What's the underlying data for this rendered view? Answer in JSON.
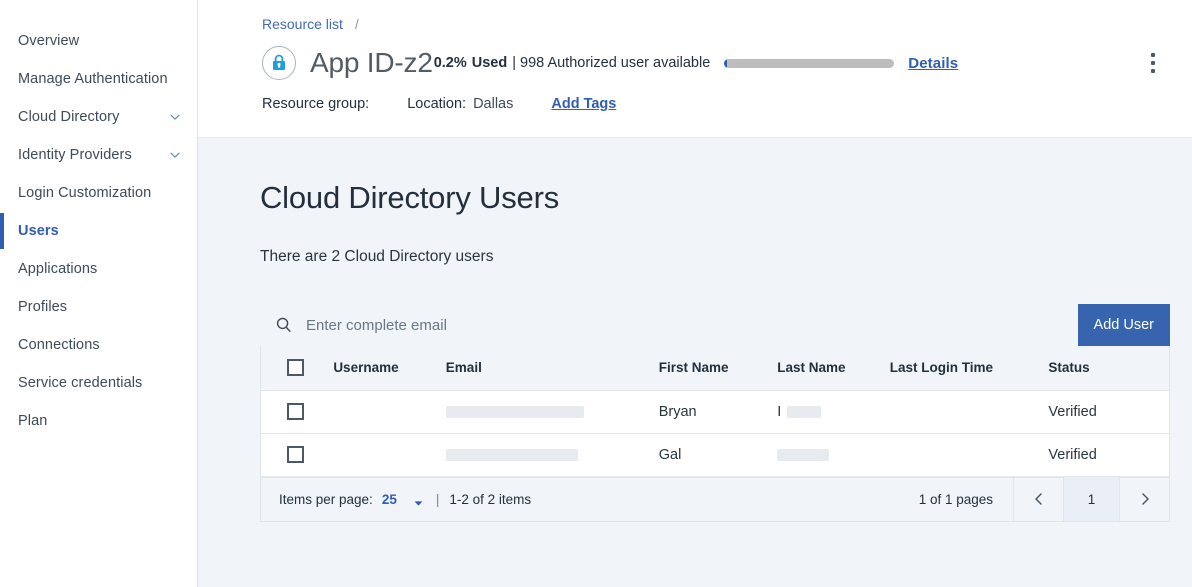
{
  "sidebar": {
    "items": [
      {
        "label": "Overview",
        "icon": null,
        "active": false
      },
      {
        "label": "Manage Authentication",
        "icon": null,
        "active": false
      },
      {
        "label": "Cloud Directory",
        "icon": "chevron-down-icon",
        "active": false
      },
      {
        "label": "Identity Providers",
        "icon": "chevron-down-icon",
        "active": false
      },
      {
        "label": "Login Customization",
        "icon": null,
        "active": false
      },
      {
        "label": "Users",
        "icon": null,
        "active": true
      },
      {
        "label": "Applications",
        "icon": null,
        "active": false
      },
      {
        "label": "Profiles",
        "icon": null,
        "active": false
      },
      {
        "label": "Connections",
        "icon": null,
        "active": false
      },
      {
        "label": "Service credentials",
        "icon": null,
        "active": false
      },
      {
        "label": "Plan",
        "icon": null,
        "active": false
      }
    ]
  },
  "header": {
    "breadcrumb": {
      "link": "Resource list",
      "separator": "/"
    },
    "resource_icon": "lock-shield-icon",
    "app_title": "App ID-z2",
    "usage_percent": "0.2%",
    "usage_used_label": "Used",
    "usage_detail": "| 998 Authorized user available",
    "usage_bar_fill_percent": 2,
    "details_link": "Details",
    "overflow_menu_icon": "kebab-menu-icon",
    "resource_group_label": "Resource group:",
    "resource_group_value": "",
    "location_label": "Location:",
    "location_value": "Dallas",
    "add_tags_link": "Add Tags"
  },
  "content": {
    "page_title": "Cloud Directory Users",
    "page_subtitle": "There are 2 Cloud Directory users",
    "search": {
      "icon": "search-icon",
      "placeholder": "Enter complete email",
      "value": ""
    },
    "add_user_button": "Add User",
    "table": {
      "select_all_checkbox": "checkbox-unchecked",
      "columns": [
        "Username",
        "Email",
        "First Name",
        "Last Name",
        "Last Login Time",
        "Status"
      ],
      "rows": [
        {
          "username": "",
          "email": "",
          "email_redacted": true,
          "first_name": "Bryan",
          "last_name": "I",
          "last_name_redacted": true,
          "last_login_time": "",
          "status": "Verified"
        },
        {
          "username": "",
          "email": "",
          "email_redacted": true,
          "first_name": "Gal",
          "last_name": "",
          "last_name_redacted": true,
          "last_login_time": "",
          "status": "Verified"
        }
      ]
    },
    "pagination": {
      "items_per_page_label": "Items per page:",
      "items_per_page_value": "25",
      "dropdown_icon": "caret-down-icon",
      "divider": "|",
      "range_text": "1-2 of 2 items",
      "pages_text": "1 of 1 pages",
      "prev_icon": "chevron-left-icon",
      "current_page": "1",
      "next_icon": "chevron-right-icon"
    }
  },
  "colors": {
    "accent_blue": "#2f5eb3",
    "button_blue": "#3664ae",
    "page_bg": "#f1f4f9",
    "text_dark": "#23303d",
    "progress_track": "#bdbdbd"
  }
}
